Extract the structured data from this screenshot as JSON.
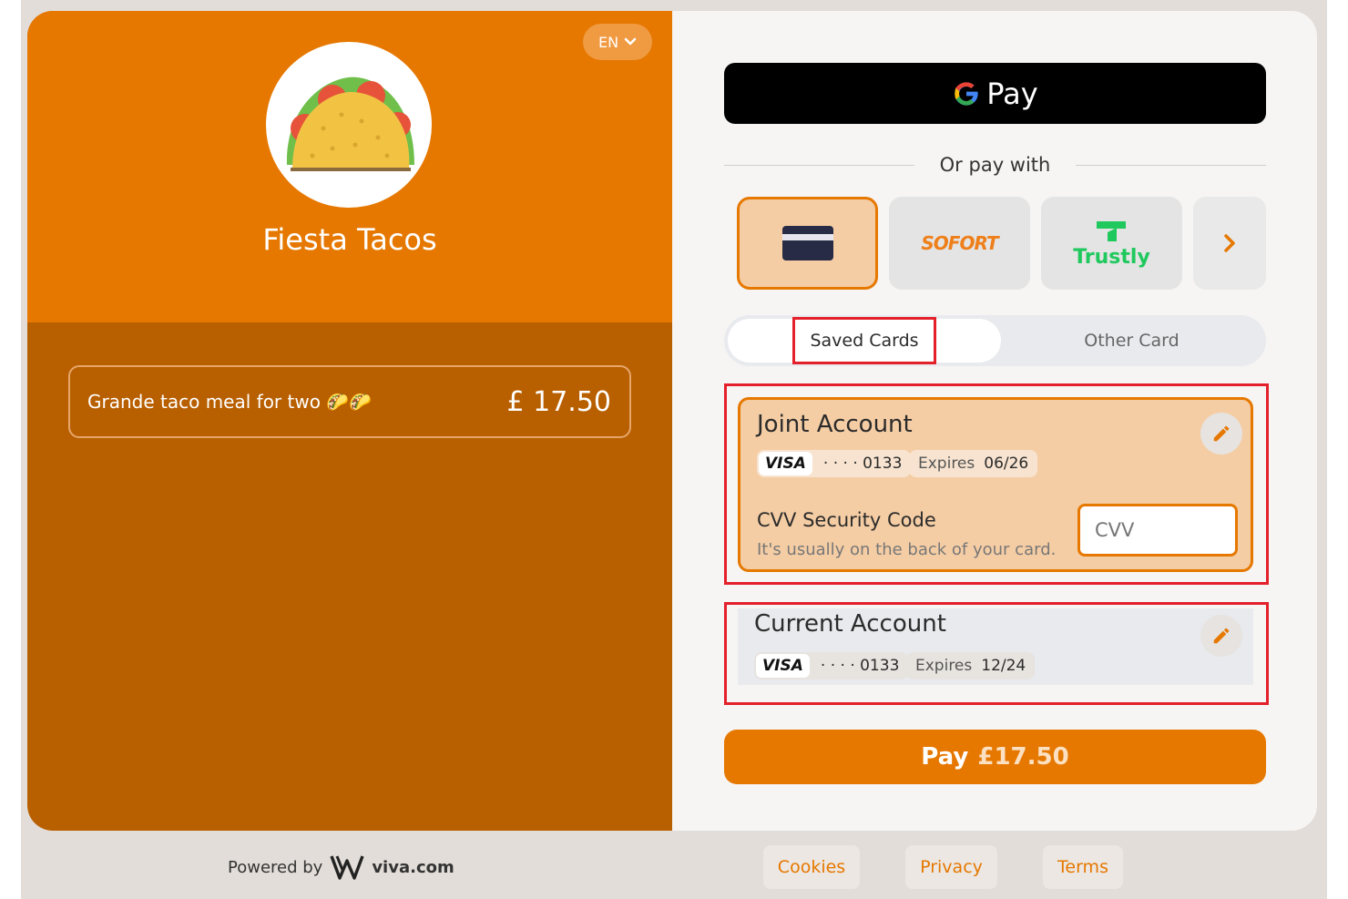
{
  "language": {
    "label": "EN",
    "icon": "chevron-down-icon"
  },
  "merchant": {
    "name": "Fiesta Tacos",
    "logo_icon": "taco-icon"
  },
  "order": {
    "description": "Grande taco meal for two 🌮🌮",
    "price": "£ 17.50"
  },
  "gpay": {
    "label": "Pay",
    "icon": "google-g-icon"
  },
  "divider": {
    "text": "Or pay with"
  },
  "payment_methods": [
    {
      "name": "card",
      "icon": "credit-card-icon",
      "active": true
    },
    {
      "name": "sofort",
      "label": "SOFORT"
    },
    {
      "name": "trustly",
      "label": "Trustly",
      "icon": "trustly-icon"
    },
    {
      "name": "more",
      "icon": "chevron-right-icon"
    }
  ],
  "tabs": {
    "saved": "Saved Cards",
    "other": "Other Card"
  },
  "accounts": [
    {
      "title": "Joint Account",
      "brand": "VISA",
      "masked": "· · · · 0133",
      "expires_label": "Expires",
      "expires": "06/26"
    },
    {
      "title": "Current Account",
      "brand": "VISA",
      "masked": "· · · · 0133",
      "expires_label": "Expires",
      "expires": "12/24"
    }
  ],
  "cvv": {
    "title": "CVV Security Code",
    "hint": "It's usually on the back of your card.",
    "placeholder": "CVV"
  },
  "pay_button": {
    "label": "Pay",
    "amount": "£17.50"
  },
  "footer": {
    "powered_by": "Powered by",
    "brand": "viva.com",
    "links": {
      "cookies": "Cookies",
      "privacy": "Privacy",
      "terms": "Terms"
    }
  },
  "colors": {
    "accent": "#e67800",
    "dark_accent": "#b85f00",
    "highlight": "#e4202b",
    "trustly": "#1fc95d"
  }
}
